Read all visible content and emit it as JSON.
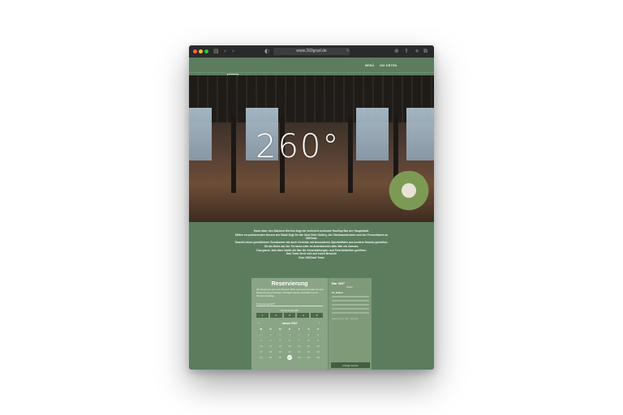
{
  "browser": {
    "url": "www.260grad.de",
    "icons": [
      "sidebar-icon",
      "back-icon",
      "forward-icon",
      "shield-icon",
      "lock-icon",
      "reload-icon",
      "download-icon",
      "share-icon",
      "plus-icon",
      "tabs-icon"
    ]
  },
  "nav": {
    "links": [
      "MENÜ",
      "260 ORTEN"
    ]
  },
  "hero": {
    "sign": "260°"
  },
  "intro": {
    "paragraphs": [
      "Hoch über den Dächern Berlins liegt die vielleicht schönste Rooftop Bar der Hauptstadt.",
      "Mitten im pulsierenden Herzen der Stadt liegt für die Gast Sieh Gallery, die Oberbaumbrücke und der Fernsehturm zu 260Grad.",
      "Sowohl einen gemütlichen Sundowner als auch Gerichte mit besonderen Spezialitäten aus buntem Snacks genießen. Ob als Ruhe auf der Terrasse oder im Innenbereich aller Mal ein Genuss.",
      "Das ganze Jahr über bleibt die Bar für Veranstaltungen und Feierlichkeiten geöffnet.",
      "Das Team freut sich auf euren Besuch!",
      "Euer 260Grad Team"
    ]
  },
  "reservation": {
    "title": "Reservierung",
    "description": "Wir freuen uns auf euren Besuch. Bitte nutzt das Formular um eine Reservierung anzufragen. Anfragen werden innerhalb von 24 Stunden bestätigt.",
    "persons_placeholder": "Personenanzahl*",
    "persons_label": "Personenanzahl",
    "persons_options": [
      "1",
      "2",
      "3",
      "4",
      "5"
    ],
    "month": "Januar 2022",
    "weekdays": [
      "M",
      "D",
      "M",
      "D",
      "F",
      "S",
      "S"
    ],
    "weeks": [
      [
        "27",
        "28",
        "29",
        "30",
        "31",
        "1",
        "2"
      ],
      [
        "3",
        "4",
        "5",
        "6",
        "7",
        "8",
        "9"
      ],
      [
        "10",
        "11",
        "12",
        "13",
        "14",
        "15",
        "16"
      ],
      [
        "17",
        "18",
        "19",
        "20",
        "21",
        "22",
        "23"
      ],
      [
        "24",
        "25",
        "26",
        "27",
        "28",
        "29",
        "30"
      ]
    ],
    "today": "27"
  },
  "sidecard": {
    "title": "Bar 260°",
    "subtitle": "Zeiten",
    "label": "24. Januar",
    "small_note": "Reservierung · Zeit · Personen",
    "submit_label": "Anfrage senden"
  }
}
